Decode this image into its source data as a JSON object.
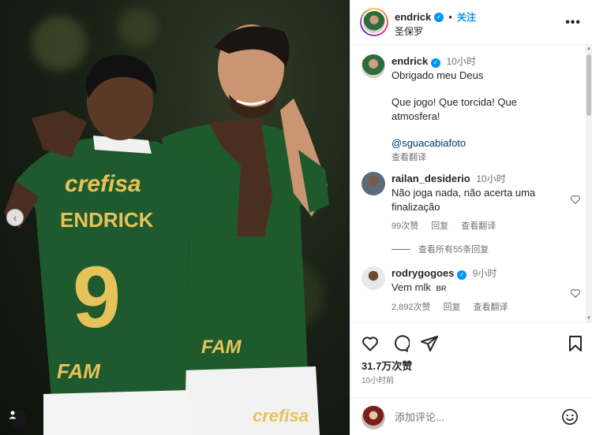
{
  "photo": {
    "jersey_sponsor": "crefisa",
    "jersey_name": "ENDRICK",
    "jersey_number": "9",
    "jersey_sponsor_bottom": "FAM",
    "shorts_sponsor": "crefisa",
    "carousel_prev_icon": "chevron-left-icon",
    "tag_icon": "person-icon"
  },
  "header": {
    "username": "endrick",
    "dot": "•",
    "follow_label": "关注",
    "location": "圣保罗",
    "more_label": "•••"
  },
  "caption": {
    "username": "endrick",
    "time": "10小时",
    "line1": "Obrigado meu Deus",
    "line2": "Que jogo! Que torcida! Que atmosfera!",
    "mention": "@sguacabiafoto",
    "translate": "查看翻译"
  },
  "comments": [
    {
      "username": "railan_desiderio",
      "time": "10小时",
      "text": "Não joga nada, não acerta uma finalização",
      "likes": "99次赞",
      "reply": "回复",
      "translate": "查看翻译"
    },
    {
      "username": "rodrygogoes",
      "time": "9小时",
      "text": "Vem mlk",
      "flag": "BR",
      "likes": "2,892次赞",
      "reply": "回复",
      "translate": "查看翻译"
    }
  ],
  "view_replies": "查看所有55条回复",
  "actions": {
    "likes": "31.7万次赞",
    "post_time": "10小时前"
  },
  "add_comment": {
    "placeholder": "添加评论..."
  },
  "colors": {
    "accent": "#0095f6",
    "jersey_green": "#1f5a2e",
    "jersey_yellow": "#e6c25a"
  }
}
